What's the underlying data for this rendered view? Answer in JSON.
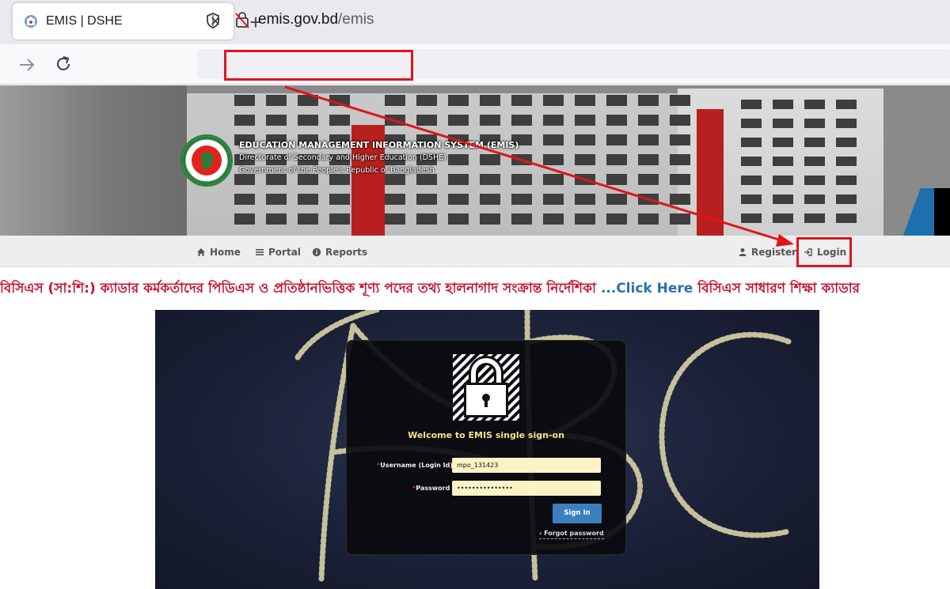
{
  "browser": {
    "tab_title": "EMIS | DSHE",
    "tab_close": "×",
    "new_tab": "+",
    "url_host": "emis.gov.bd",
    "url_path": "/emis"
  },
  "site": {
    "title": "EDUCATION MANAGEMENT INFORMATION SYSTEM (EMIS)",
    "subtitle1": "Directorate of Secondary and Higher Education (DSHE)",
    "subtitle2": "Government of the People's Republic of Bangladesh"
  },
  "menu": {
    "home": "Home",
    "portal": "Portal",
    "reports": "Reports",
    "register": "Register",
    "login": "Login"
  },
  "marquee": {
    "part1": "বিসিএস (সা:শি:) ক্যাডার কর্মকর্তাদের পিডিএস ও প্রতিষ্ঠানভিত্তিক শূণ্য পদের তথ্য হালনাগাদ সংক্রান্ত নির্দেশিকা ",
    "click": "...Click Here",
    "part2": " বিসিএস সাধারণ শিক্ষা ক্যাডার"
  },
  "login": {
    "welcome": "Welcome to EMIS single sign-on",
    "username_label": "Username (Login Id)",
    "username_value": "mpo_131423",
    "password_label": "Password",
    "password_value": "•••••••••••••••",
    "required_mark": "*",
    "signin_label": "Sign In",
    "forgot_label": "Forgot password"
  },
  "colors": {
    "highlight": "#e0141c",
    "marquee_text": "#c8102e",
    "click_here": "#2a6fb0",
    "signin_button": "#3b7fbf",
    "welcome_text": "#f2e38f",
    "input_bg": "#fbf3c5"
  }
}
